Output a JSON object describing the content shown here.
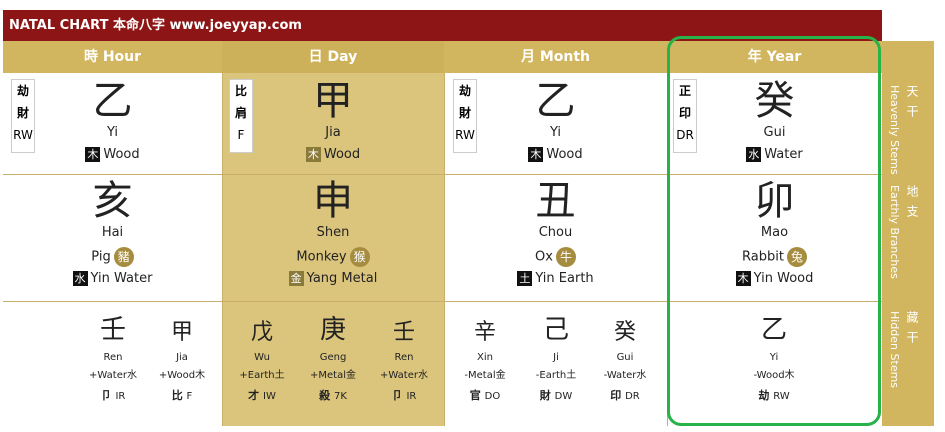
{
  "title": "NATAL CHART 本命八字 www.joeyyap.com",
  "columns": [
    {
      "header": "時 Hour",
      "stem": {
        "char": "乙",
        "pinyin": "Yi",
        "elem_char": "木",
        "elem": "Wood"
      },
      "ten_god": {
        "c1": "劫",
        "c2": "財",
        "code": "RW"
      },
      "branch": {
        "char": "亥",
        "pinyin": "Hai",
        "animal": "Pig",
        "animal_char": "豬",
        "elem_char": "水",
        "elem": "Yin Water"
      },
      "hidden": [
        {
          "char": "壬",
          "name": "Ren",
          "elem": "+Water水",
          "god": "卩",
          "code": "IR"
        },
        {
          "char": "甲",
          "name": "Jia",
          "elem": "+Wood木",
          "god": "比",
          "code": "F"
        }
      ]
    },
    {
      "header": "日 Day",
      "stem": {
        "char": "甲",
        "pinyin": "Jia",
        "elem_char": "木",
        "elem": "Wood"
      },
      "ten_god": {
        "c1": "比",
        "c2": "肩",
        "code": "F"
      },
      "branch": {
        "char": "申",
        "pinyin": "Shen",
        "animal": "Monkey",
        "animal_char": "猴",
        "elem_char": "金",
        "elem": "Yang Metal"
      },
      "hidden": [
        {
          "char": "戊",
          "name": "Wu",
          "elem": "+Earth土",
          "god": "才",
          "code": "IW"
        },
        {
          "char": "庚",
          "name": "Geng",
          "elem": "+Metal金",
          "god": "殺",
          "code": "7K"
        },
        {
          "char": "壬",
          "name": "Ren",
          "elem": "+Water水",
          "god": "卩",
          "code": "IR"
        }
      ]
    },
    {
      "header": "月 Month",
      "stem": {
        "char": "乙",
        "pinyin": "Yi",
        "elem_char": "木",
        "elem": "Wood"
      },
      "ten_god": {
        "c1": "劫",
        "c2": "財",
        "code": "RW"
      },
      "branch": {
        "char": "丑",
        "pinyin": "Chou",
        "animal": "Ox",
        "animal_char": "牛",
        "elem_char": "土",
        "elem": "Yin Earth"
      },
      "hidden": [
        {
          "char": "辛",
          "name": "Xin",
          "elem": "-Metal金",
          "god": "官",
          "code": "DO"
        },
        {
          "char": "己",
          "name": "Ji",
          "elem": "-Earth土",
          "god": "財",
          "code": "DW"
        },
        {
          "char": "癸",
          "name": "Gui",
          "elem": "-Water水",
          "god": "印",
          "code": "DR"
        }
      ]
    },
    {
      "header": "年 Year",
      "stem": {
        "char": "癸",
        "pinyin": "Gui",
        "elem_char": "水",
        "elem": "Water"
      },
      "ten_god": {
        "c1": "正",
        "c2": "印",
        "code": "DR"
      },
      "branch": {
        "char": "卯",
        "pinyin": "Mao",
        "animal": "Rabbit",
        "animal_char": "兔",
        "elem_char": "木",
        "elem": "Yin Wood"
      },
      "hidden": [
        {
          "char": "乙",
          "name": "Yi",
          "elem": "-Wood木",
          "god": "劫",
          "code": "RW"
        }
      ]
    }
  ],
  "side": {
    "stems": {
      "zh": "天 干",
      "en": "Heavenly Stems"
    },
    "branches": {
      "zh": "地 支",
      "en": "Earthly Branches"
    },
    "hidden": {
      "zh": "藏 干",
      "en": "Hidden Stems"
    }
  },
  "colors": {
    "title_bg": "#8e1515",
    "header_bg": "#d2b65f",
    "day_bg": "#dbc57c",
    "highlight": "#27b24a"
  }
}
